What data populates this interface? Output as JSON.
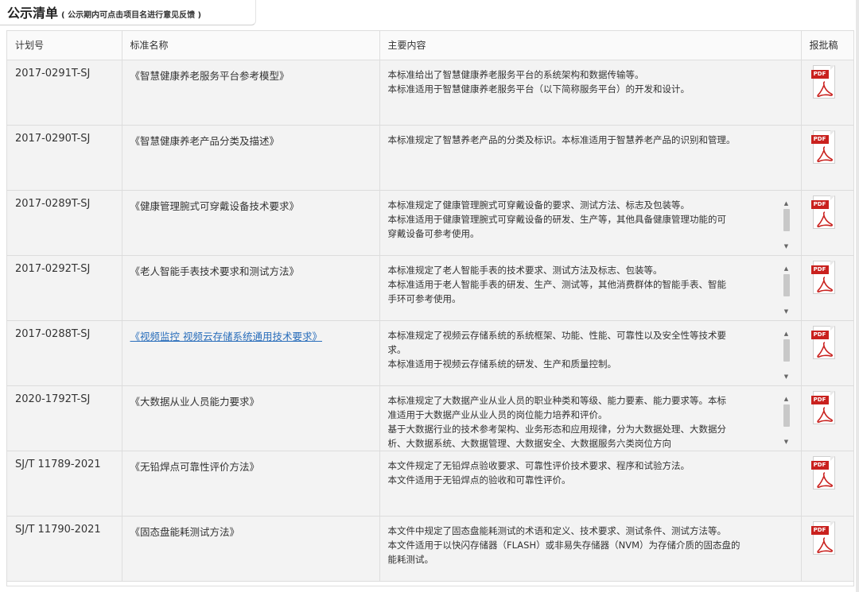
{
  "section": {
    "title": "公示清单",
    "note": "( 公示期内可点击项目名进行意见反馈 )"
  },
  "table": {
    "headers": [
      "计划号",
      "标准名称",
      "主要内容",
      "报批稿"
    ],
    "rows": [
      {
        "code": "2017-0291T-SJ",
        "name": "《智慧健康养老服务平台参考模型》",
        "content": [
          "本标准给出了智慧健康养老服务平台的系统架构和数据传输等。",
          "本标准适用于智慧健康养老服务平台（以下简称服务平台）的开发和设计。"
        ],
        "pdf_label": "PDF"
      },
      {
        "code": "2017-0290T-SJ",
        "name": "《智慧健康养老产品分类及描述》",
        "content": [
          "本标准规定了智慧养老产品的分类及标识。本标准适用于智慧养老产品的识别和管理。"
        ],
        "pdf_label": "PDF"
      },
      {
        "code": "2017-0289T-SJ",
        "name": "《健康管理腕式可穿戴设备技术要求》",
        "content": [
          "本标准规定了健康管理腕式可穿戴设备的要求、测试方法、标志及包装等。",
          "本标准适用于健康管理腕式可穿戴设备的研发、生产等，其他具备健康管理功能的可",
          "穿戴设备可参考使用。"
        ],
        "pdf_label": "PDF"
      },
      {
        "code": "2017-0292T-SJ",
        "name": "《老人智能手表技术要求和测试方法》",
        "content": [
          "本标准规定了老人智能手表的技术要求、测试方法及标志、包装等。",
          "本标准适用于老人智能手表的研发、生产、测试等，其他消费群体的智能手表、智能",
          "手环可参考使用。"
        ],
        "pdf_label": "PDF"
      },
      {
        "code": "2017-0288T-SJ",
        "name": "《视频监控 视频云存储系统通用技术要求》",
        "content": [
          "本标准规定了视频云存储系统的系统框架、功能、性能、可靠性以及安全性等技术要",
          "求。",
          "本标准适用于视频云存储系统的研发、生产和质量控制。"
        ],
        "pdf_label": "PDF"
      },
      {
        "code": "2020-1792T-SJ",
        "name": "《大数据从业人员能力要求》",
        "content": [
          "本标准规定了大数据产业从业人员的职业种类和等级、能力要素、能力要求等。本标",
          "准适用于大数据产业从业人员的岗位能力培养和评价。",
          "基于大数据行业的技术参考架构、业务形态和应用规律，分为大数据处理、大数据分",
          "析、大数据系统、大数据管理、大数据安全、大数据服务六类岗位方向"
        ],
        "pdf_label": "PDF"
      },
      {
        "code": "SJ/T 11789-2021",
        "name": "《无铅焊点可靠性评价方法》",
        "content": [
          "本文件规定了无铅焊点验收要求、可靠性评价技术要求、程序和试验方法。",
          "本文件适用于无铅焊点的验收和可靠性评价。"
        ],
        "pdf_label": "PDF"
      },
      {
        "code": "SJ/T 11790-2021",
        "name": "《固态盘能耗测试方法》",
        "content": [
          "本文件中规定了固态盘能耗测试的术语和定义、技术要求、测试条件、测试方法等。",
          "本文件适用于以快闪存储器（FLASH）或非易失存储器（NVM）为存储介质的固态盘的",
          "能耗测试。"
        ],
        "pdf_label": "PDF"
      }
    ]
  },
  "colors": {
    "pdf_red": "#c9211e",
    "link_blue": "#2a6ebb"
  }
}
